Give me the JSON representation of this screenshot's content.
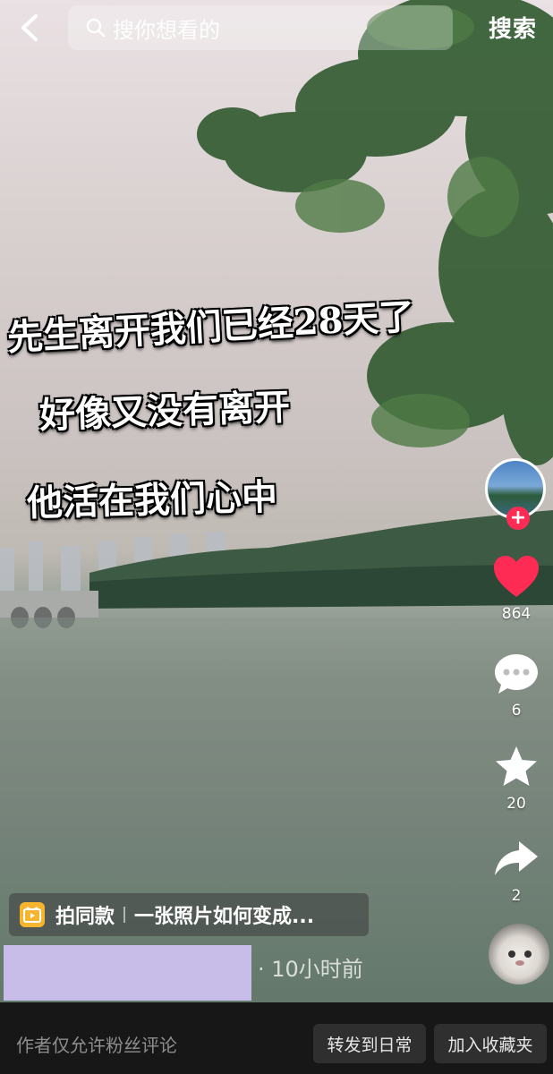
{
  "search": {
    "placeholder": "搜你想看的",
    "submit_label": "搜索"
  },
  "video": {
    "caption_lines": [
      "先生离开我们已经28天了",
      "好像又没有离开",
      "他活在我们心中"
    ]
  },
  "actions": {
    "likes": "864",
    "comments": "6",
    "favorites": "20",
    "shares": "2"
  },
  "tag": {
    "label": "拍同款",
    "text": "一张照片如何变成..."
  },
  "author": {
    "time_ago": "· 10小时前"
  },
  "bottom_bar": {
    "comment_hint": "作者仅允许粉丝评论",
    "repost_label": "转发到日常",
    "collect_label": "加入收藏夹"
  },
  "colors": {
    "like": "#fe2c55",
    "tag_icon": "#f5b52e",
    "redaction": "#c8bde8",
    "bottom_bar": "#171717"
  }
}
